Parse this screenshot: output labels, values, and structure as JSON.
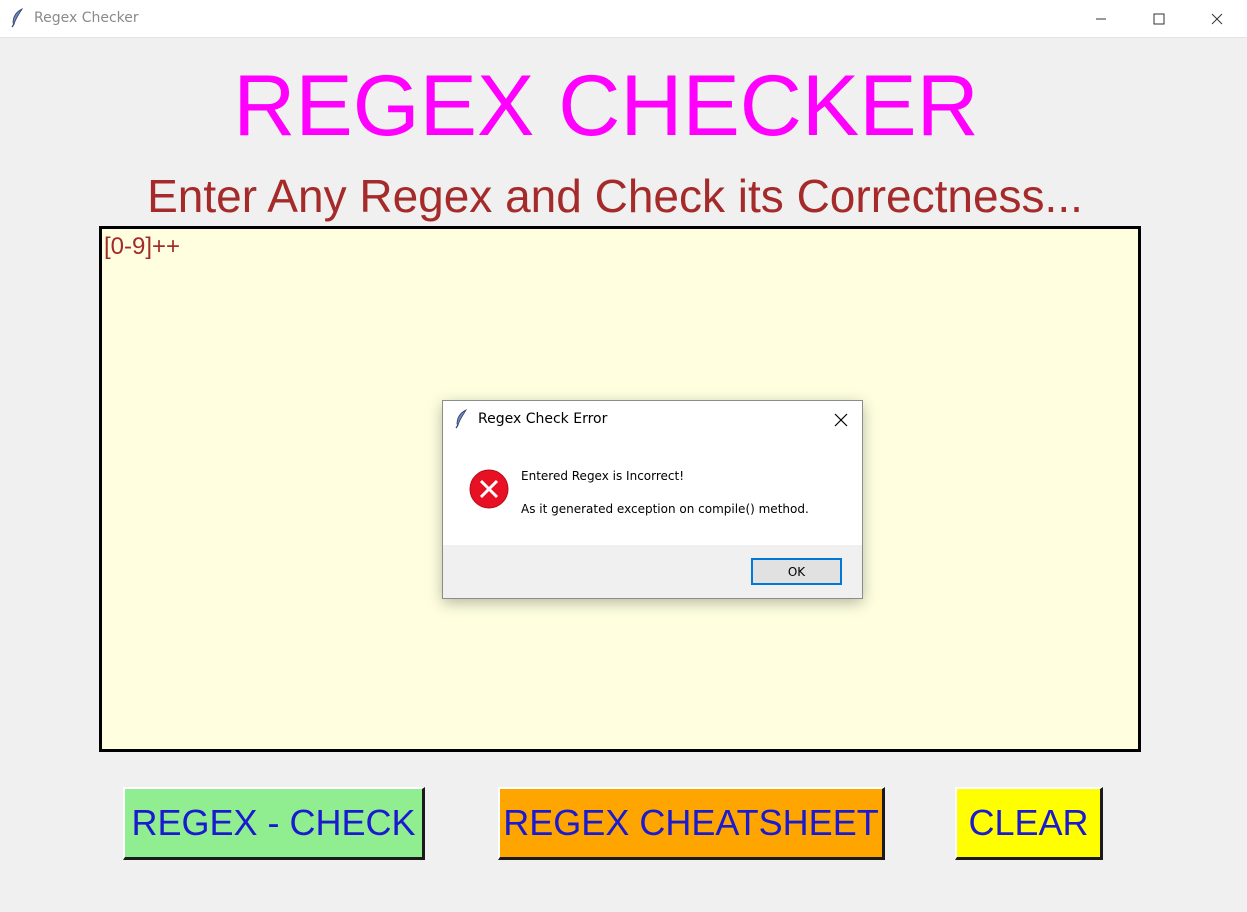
{
  "window": {
    "title": "Regex Checker",
    "icon": "feather-icon",
    "controls": [
      "minimize-icon",
      "maximize-icon",
      "close-icon"
    ]
  },
  "app": {
    "title": "REGEX CHECKER",
    "subtitle": "Enter Any Regex and Check its Correctness...",
    "input_value": "[0-9]++",
    "buttons": {
      "check": "REGEX - CHECK",
      "cheatsheet": "REGEX CHEATSHEET",
      "clear": "CLEAR"
    }
  },
  "dialog": {
    "title": "Regex Check Error",
    "icon": "error-icon",
    "message_line1": "Entered Regex is Incorrect!",
    "message_line2": "As it generated exception on compile() method.",
    "ok_label": "OK"
  },
  "colors": {
    "title": "#ff00ff",
    "subtitle": "#a52a2a",
    "input_bg": "#ffffe0",
    "check_button": "#90ee90",
    "cheatsheet_button": "#ffa500",
    "clear_button": "#ffff00",
    "button_text": "#1a1ad0",
    "error_red": "#e81123",
    "ok_border": "#0078d7"
  }
}
